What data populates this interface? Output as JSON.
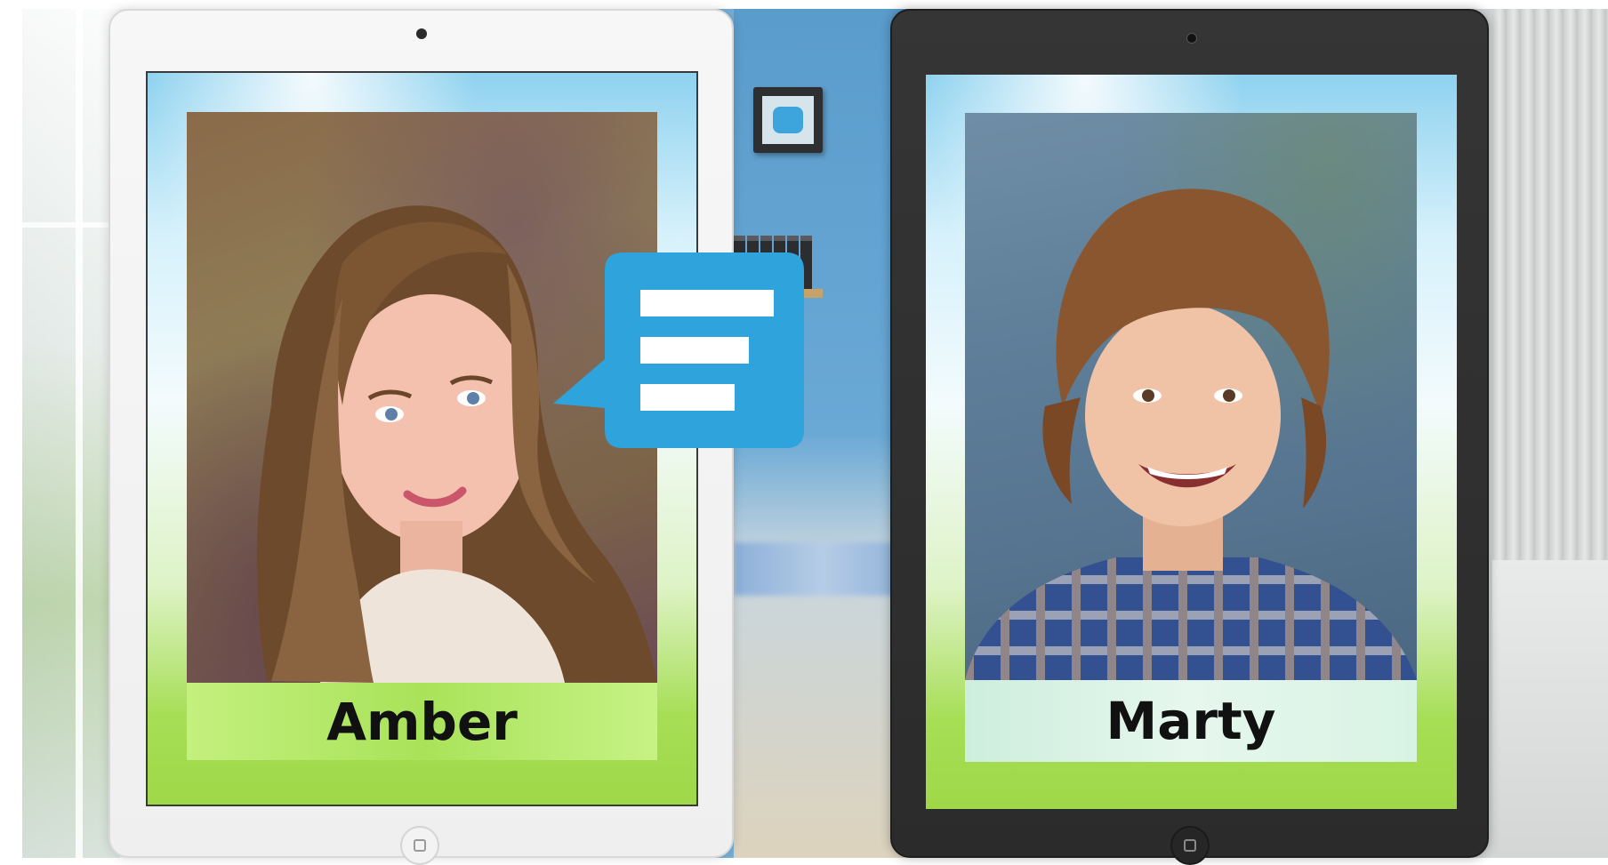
{
  "profiles": [
    {
      "name": "Amber"
    },
    {
      "name": "Marty"
    }
  ],
  "colors": {
    "chat_bubble": "#2ea3dc",
    "nameplate_amber": "#a9e35a",
    "nameplate_marty": "#e2f5ea"
  },
  "icons": [
    "chat-bubble-icon",
    "home-button-icon",
    "camera-icon"
  ]
}
